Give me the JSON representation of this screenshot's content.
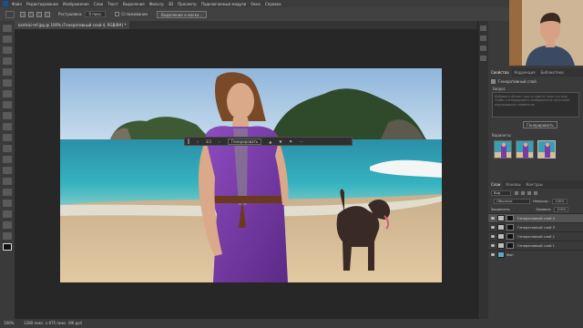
{
  "menubar": {
    "items": [
      "Файл",
      "Редактирование",
      "Изображение",
      "Слои",
      "Текст",
      "Выделение",
      "Фильтр",
      "3D",
      "Просмотр",
      "Подключаемые модули",
      "Окно",
      "Справка"
    ]
  },
  "options": {
    "feather_label": "Растушевка:",
    "feather_value": "0 пикс.",
    "antialias_label": "Сглаживание",
    "select_mask_button": "Выделение и маска..."
  },
  "document": {
    "tab_title": "kartinki-mf.jpg @ 100% (Генеративный слой 4, RGB/8#) *"
  },
  "context_bar": {
    "counter": "3/3",
    "generate_label": "Генерировать",
    "more": "···"
  },
  "status": {
    "zoom": "100%",
    "dimensions": "1280 пикс. x 675 пикс. (96 ppi)"
  },
  "properties_panel": {
    "tabs": [
      "Свойства",
      "Коррекция",
      "Библиотеки"
    ],
    "layer_type": "Генеративный слой",
    "prompt_label": "Запрос",
    "prompt_text": "Добавьте объект или оставьте поле пустым, чтобы сгенерировать изображение на основе окружающих элементов",
    "generate_button": "Генерировать",
    "variants_label": "Варианты"
  },
  "layers_panel": {
    "tabs": [
      "Слои",
      "Каналы",
      "Контуры"
    ],
    "filter_value": "Вид",
    "blend_mode": "Обычные",
    "opacity_label": "Непрозр.:",
    "opacity_value": "100%",
    "lock_label": "Закрепить:",
    "fill_label": "Заливка:",
    "fill_value": "100%",
    "layers": [
      {
        "name": "Генеративный слой 4",
        "selected": true
      },
      {
        "name": "Генеративный слой 3",
        "selected": false
      },
      {
        "name": "Генеративный слой 2",
        "selected": false
      },
      {
        "name": "Генеративный слой 1",
        "selected": false
      },
      {
        "name": "Фон",
        "selected": false
      }
    ]
  },
  "colors": {
    "app_bg": "#282828",
    "panel_bg": "#3a3a3a",
    "dress_purple": "#7a3aa8",
    "sea": "#2f9fb1"
  }
}
